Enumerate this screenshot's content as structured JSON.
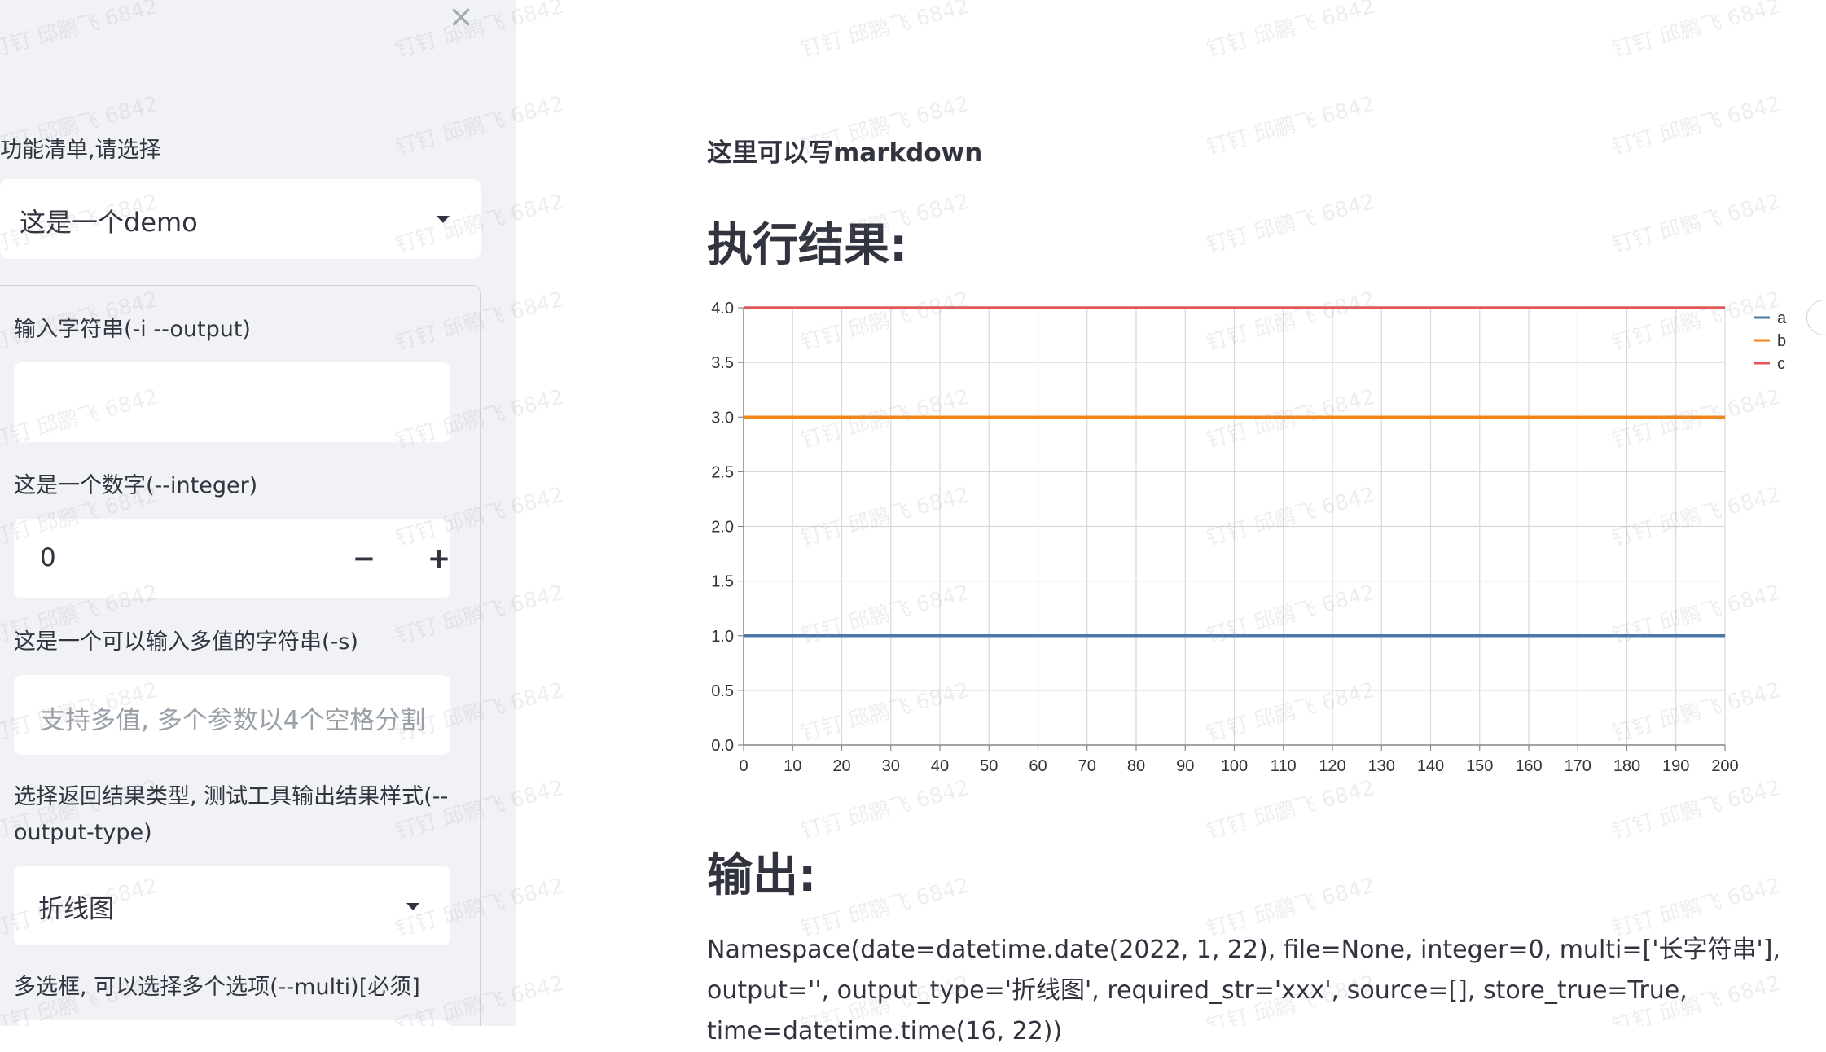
{
  "sidebar": {
    "close_icon": "×",
    "function_label": "功能清单,请选择",
    "function_value": "这是一个demo",
    "fields": {
      "output_label": "输入字符串(-i --output)",
      "output_value": "",
      "integer_label": "这是一个数字(--integer)",
      "integer_value": "0",
      "minus": "−",
      "plus": "+",
      "multi_str_label": "这是一个可以输入多值的字符串(-s)",
      "multi_str_placeholder": "支持多值, 多个参数以4个空格分割",
      "type_label": "选择返回结果类型, 测试工具输出结果样式(--output-type)",
      "type_value": "折线图",
      "multi_label": "多选框, 可以选择多个选项(--multi)[必须]"
    }
  },
  "main": {
    "markdown_text": "这里可以写markdown",
    "result_heading": "执行结果:",
    "output_heading": "输出:",
    "output_text": "Namespace(date=datetime.date(2022, 1, 22), file=None, integer=0, multi=['长字符串'], output='', output_type='折线图', required_str='xxx', source=[], store_true=True, time=datetime.time(16, 22))"
  },
  "watermark_text": "钉钉 邱鹏飞 6842",
  "chart_data": {
    "type": "line",
    "x": [
      0,
      200
    ],
    "x_ticks": [
      0,
      10,
      20,
      30,
      40,
      50,
      60,
      70,
      80,
      90,
      100,
      110,
      120,
      130,
      140,
      150,
      160,
      170,
      180,
      190,
      200
    ],
    "y_ticks": [
      "0.0",
      "0.5",
      "1.0",
      "1.5",
      "2.0",
      "2.5",
      "3.0",
      "3.5",
      "4.0"
    ],
    "xlim": [
      0,
      200
    ],
    "ylim": [
      0,
      4
    ],
    "grid": true,
    "legend": "right",
    "series": [
      {
        "name": "a",
        "values": [
          1,
          1
        ],
        "color": "#4c78a8"
      },
      {
        "name": "b",
        "values": [
          3,
          3
        ],
        "color": "#f58518"
      },
      {
        "name": "c",
        "values": [
          4,
          4
        ],
        "color": "#e45756"
      }
    ]
  }
}
